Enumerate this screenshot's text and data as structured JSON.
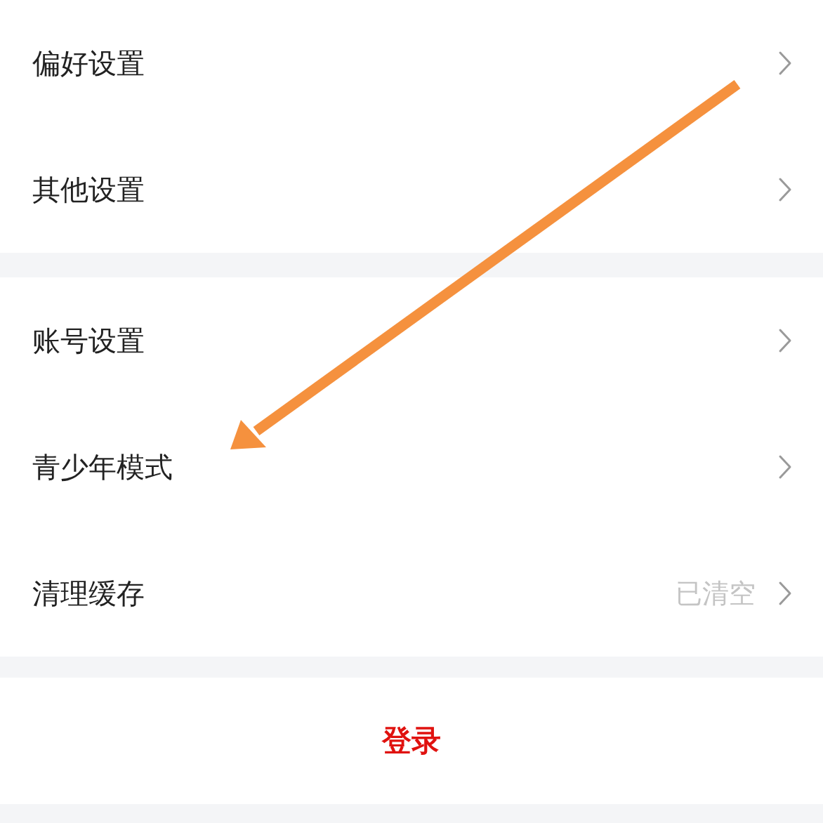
{
  "groups": [
    {
      "items": [
        {
          "label": "偏好设置"
        },
        {
          "label": "其他设置"
        }
      ]
    },
    {
      "items": [
        {
          "label": "账号设置"
        },
        {
          "label": "青少年模式"
        },
        {
          "label": "清理缓存",
          "value": "已清空"
        }
      ]
    }
  ],
  "login_button": {
    "label": "登录"
  }
}
